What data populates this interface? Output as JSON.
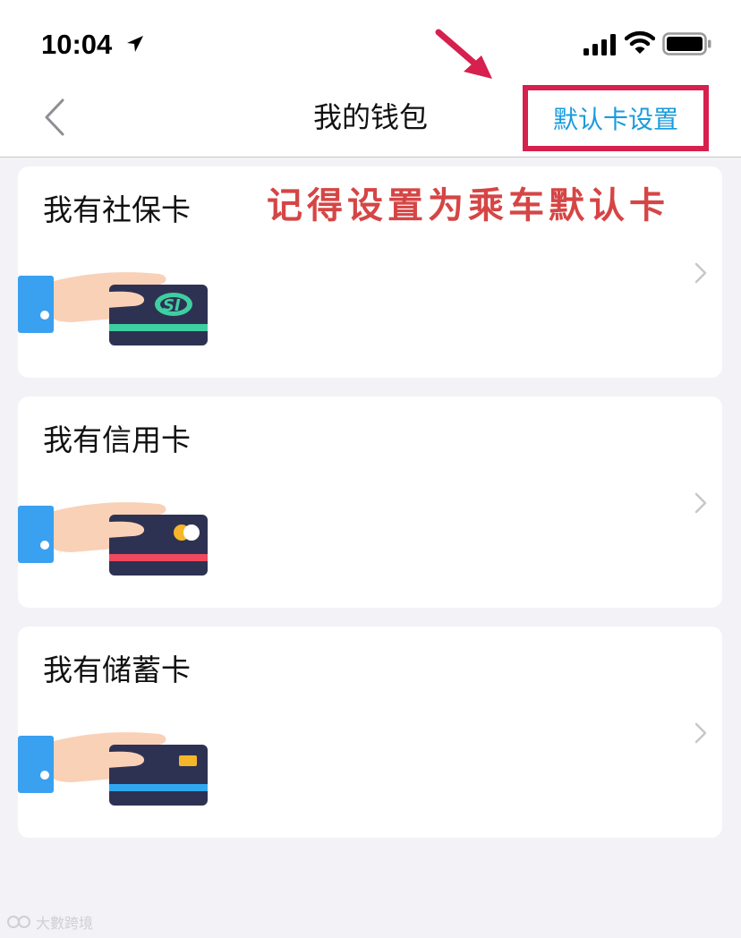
{
  "status_bar": {
    "time": "10:04"
  },
  "nav": {
    "title": "我的钱包",
    "default_card_setting": "默认卡设置"
  },
  "annotation": {
    "text": "记得设置为乘车默认卡",
    "color": "#d64545"
  },
  "cards": [
    {
      "title": "我有社保卡",
      "icon": "social-security-card-icon",
      "accent": "#3ecfa1"
    },
    {
      "title": "我有信用卡",
      "icon": "credit-card-icon",
      "accent": "#f0485e"
    },
    {
      "title": "我有储蓄卡",
      "icon": "debit-card-icon",
      "accent": "#2fa8f0"
    }
  ],
  "colors": {
    "link_blue": "#1a9bdc",
    "highlight_red": "#d6204d",
    "background": "#f2f2f7"
  },
  "watermark": "大數跨境"
}
